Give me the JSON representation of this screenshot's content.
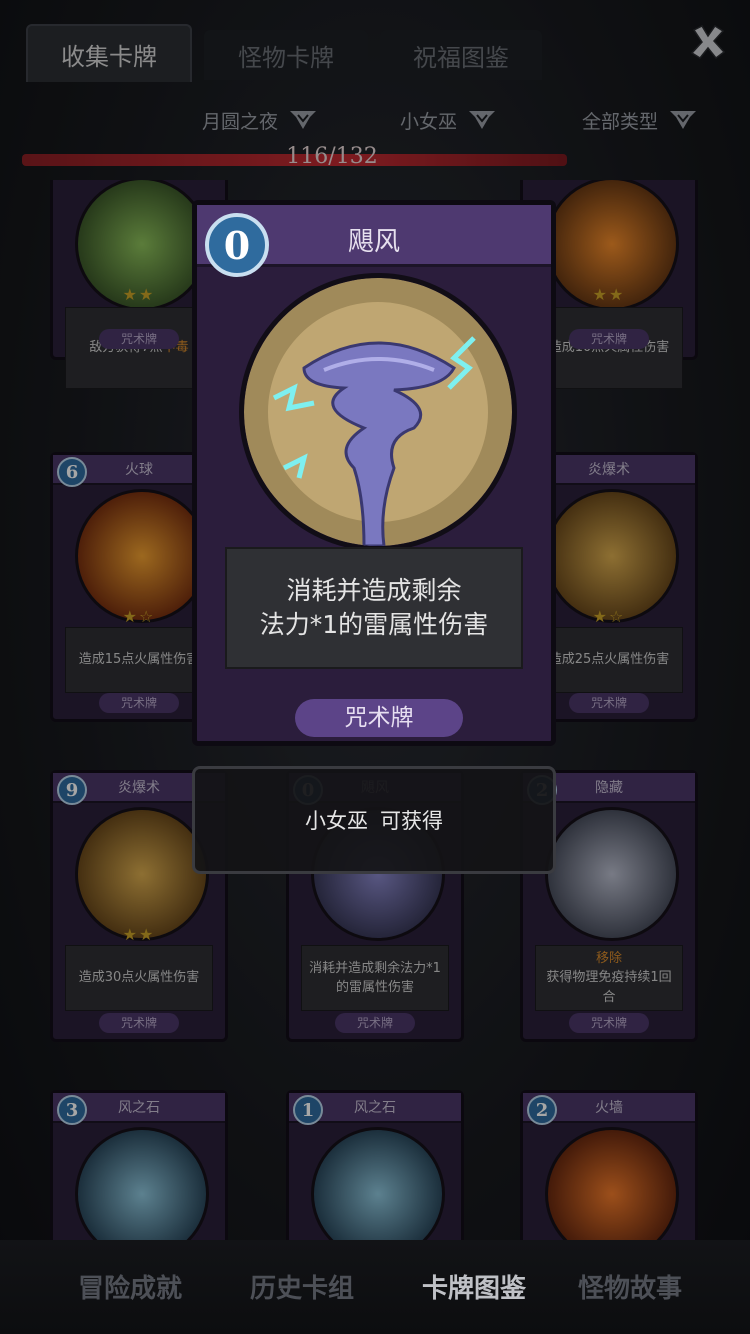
{
  "tabs": [
    {
      "label": "收集卡牌",
      "active": true
    },
    {
      "label": "怪物卡牌",
      "active": false
    },
    {
      "label": "祝福图鉴",
      "active": false
    }
  ],
  "filters": {
    "stage": "月圆之夜",
    "character": "小女巫",
    "type": "全部类型"
  },
  "collection": {
    "progress_text": "116/132",
    "collected": 116,
    "total": 132
  },
  "grid_cards": [
    {
      "cost": "",
      "name": "",
      "desc_pre": "敌方获得7点",
      "desc_hl": "中毒",
      "type": "咒术牌",
      "stars": "★★",
      "color": "#6fa04a"
    },
    {
      "cost": "",
      "name": "",
      "desc": "造成10点火属性伤害",
      "type": "咒术牌",
      "stars": "★★",
      "color": "#d8621c"
    },
    {
      "cost": "6",
      "name": "火球",
      "desc": "造成15点火属性伤害",
      "type": "咒术牌",
      "stars": "★☆",
      "color": "#d8621c"
    },
    {
      "cost": "",
      "name": "炎爆术",
      "desc": "造成25点火属性伤害",
      "type": "咒术牌",
      "stars": "★☆",
      "color": "#c89a3a"
    },
    {
      "cost": "9",
      "name": "炎爆术",
      "desc": "造成30点火属性伤害",
      "type": "咒术牌",
      "stars": "★★",
      "color": "#c89a3a"
    },
    {
      "cost": "0",
      "name": "飓风",
      "desc": "消耗并造成剩余法力*1的雷属性伤害",
      "type": "咒术牌",
      "stars": "",
      "color": "#6d6bb0"
    },
    {
      "cost": "2",
      "name": "隐藏",
      "desc_hl": "移除",
      "desc": "获得物理免疫持续1回合",
      "type": "咒术牌",
      "stars": "",
      "color": "#a6a8b8"
    },
    {
      "cost": "3",
      "name": "风之石",
      "color": "#5a8aa8"
    },
    {
      "cost": "1",
      "name": "风之石",
      "color": "#5a8aa8"
    },
    {
      "cost": "2",
      "name": "火墙",
      "color": "#d05a1c"
    }
  ],
  "modal_card": {
    "cost": "0",
    "name": "飓风",
    "desc_line1": "消耗并造成剩余",
    "desc_line2": "法力*1的雷属性伤害",
    "type": "咒术牌"
  },
  "popup": {
    "character": "小女巫",
    "text": "可获得"
  },
  "bottom_nav": [
    {
      "label": "冒险成就",
      "active": false
    },
    {
      "label": "历史卡组",
      "active": false
    },
    {
      "label": "卡牌图鉴",
      "active": true
    },
    {
      "label": "怪物故事",
      "active": false
    }
  ],
  "colors": {
    "accent_purple": "#4e3970",
    "cost_blue": "#2f6b9e",
    "progress_red": "#c12a31"
  },
  "icons": [
    "close-icon",
    "chevron-down-icon",
    "star-icon"
  ]
}
